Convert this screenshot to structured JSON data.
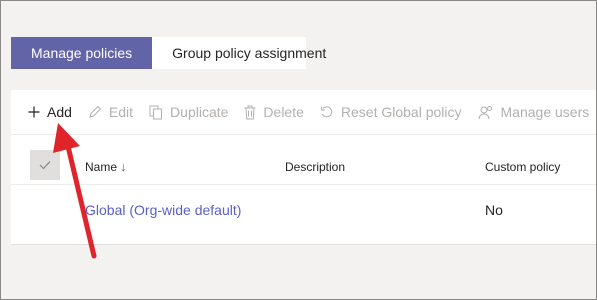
{
  "tabs": [
    {
      "label": "Manage policies",
      "active": true
    },
    {
      "label": "Group policy assignment",
      "active": false
    }
  ],
  "toolbar": {
    "add": "Add",
    "edit": "Edit",
    "duplicate": "Duplicate",
    "delete": "Delete",
    "reset": "Reset Global policy",
    "manage": "Manage users"
  },
  "table": {
    "columns": {
      "name": "Name",
      "description": "Description",
      "custom": "Custom policy"
    },
    "sort_indicator": "↓",
    "rows": [
      {
        "name": "Global (Org-wide default)",
        "description": "",
        "custom": "No"
      }
    ]
  },
  "colors": {
    "accent": "#6264a7",
    "link": "#5b5fc7",
    "annotation": "#e0242c"
  }
}
